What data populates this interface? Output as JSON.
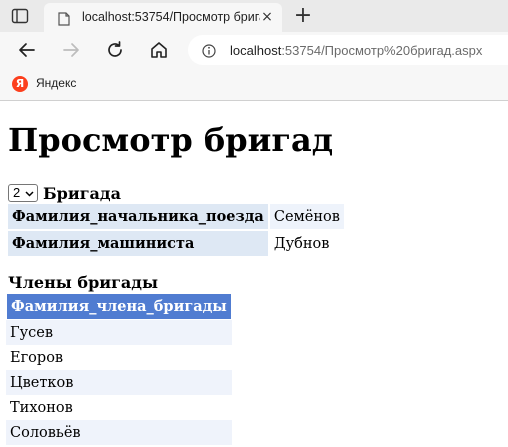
{
  "browser": {
    "tab_title": "localhost:53754/Просмотр бригад",
    "close_glyph": "×",
    "new_tab_glyph": "+",
    "url_host": "localhost",
    "url_rest": ":53754/Просмотр%20бригад.aspx",
    "bookmark_label": "Яндекс",
    "bookmark_icon_letter": "Я"
  },
  "page": {
    "title": "Просмотр бригад",
    "brigade_select_value": "2",
    "brigade_label": "Бригада",
    "info_rows": [
      {
        "field": "Фамилия_начальника_поезда",
        "value": "Семёнов"
      },
      {
        "field": "Фамилия_машиниста",
        "value": "Дубнов"
      }
    ],
    "members_title": "Члены бригады",
    "members_header": "Фамилия_члена_бригады",
    "members": [
      "Гусев",
      "Егоров",
      "Цветков",
      "Тихонов",
      "Соловьёв"
    ]
  },
  "colors": {
    "grid_header": "#507cd1",
    "row_alt": "#eff3fb",
    "info_field_bg": "#dee8f4",
    "yandex": "#fc3f1d"
  }
}
